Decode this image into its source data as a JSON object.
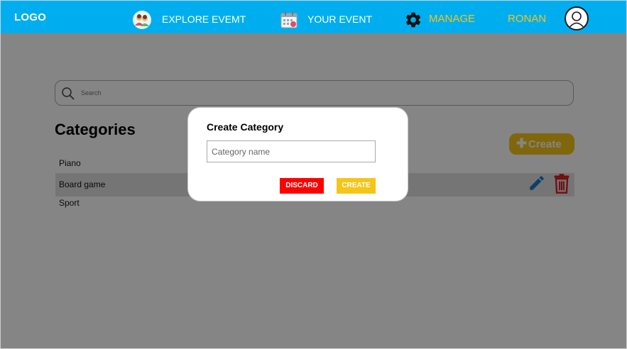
{
  "header": {
    "logo": "LOGO",
    "nav": {
      "explore": "EXPLORE EVEMT",
      "your_event": "YOUR EVENT",
      "manage": "MANAGE",
      "user": "RONAN"
    }
  },
  "search": {
    "placeholder": "Search"
  },
  "page": {
    "title": "Categories",
    "create_button": "Create",
    "categories": [
      "Piano",
      "Board game",
      "Sport"
    ]
  },
  "modal": {
    "title": "Create Category",
    "input_placeholder": "Category name",
    "discard_label": "DISCARD",
    "create_label": "CREATE"
  },
  "colors": {
    "header_bg": "#00aeef",
    "accent_yellow": "#f5c518",
    "discard_red": "#ff0000",
    "edit_blue": "#1e78c8",
    "delete_red": "#d81b1b"
  },
  "icons": [
    "explore-icon",
    "calendar-icon",
    "gear-icon",
    "avatar-icon",
    "search-icon",
    "plus-icon",
    "pencil-icon",
    "trash-icon"
  ]
}
